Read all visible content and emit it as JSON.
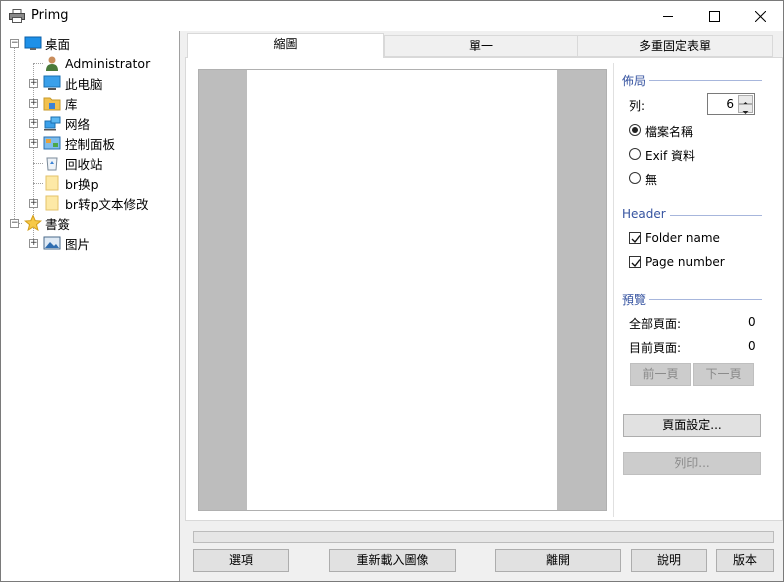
{
  "window": {
    "title": "Primg"
  },
  "tree": {
    "root": "桌面",
    "items": [
      "Administrator",
      "此电脑",
      "库",
      "网络",
      "控制面板",
      "回收站",
      "br换p",
      "br转p文本修改"
    ],
    "bookmarks": {
      "label": "書簽",
      "items": [
        "图片"
      ]
    },
    "expand_glyph": "+",
    "collapse_glyph": "−"
  },
  "tabs": [
    "縮圖",
    "單一",
    "多重固定表單"
  ],
  "layout": {
    "title": "佈局",
    "columns_label": "列:",
    "columns_value": "6",
    "radio_options": [
      "檔案名稱",
      "Exif 資料",
      "無"
    ],
    "selected_radio": 0
  },
  "header": {
    "title": "Header",
    "checks": [
      {
        "label": "Folder name",
        "checked": true
      },
      {
        "label": "Page number",
        "checked": true
      }
    ]
  },
  "preview": {
    "title": "預覽",
    "total_pages_label": "全部頁面:",
    "total_pages_value": "0",
    "current_page_label": "目前頁面:",
    "current_page_value": "0",
    "prev_label": "前一頁",
    "next_label": "下一頁"
  },
  "page_setup_label": "頁面設定...",
  "print_label": "列印...",
  "bottom_buttons": [
    "選項",
    "重新載入圖像",
    "離開",
    "說明",
    "版本"
  ],
  "progress": 0
}
